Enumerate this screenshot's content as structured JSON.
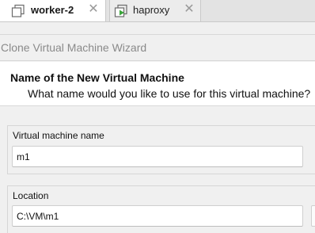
{
  "tabs": [
    {
      "label": "worker-2",
      "icon": "vm-window-icon",
      "active": true,
      "close_glyph": "✕"
    },
    {
      "label": "haproxy",
      "icon": "vm-running-icon",
      "active": false,
      "close_glyph": "✕"
    }
  ],
  "wizard": {
    "title": "Clone Virtual Machine Wizard",
    "page_title": "Name of the New Virtual Machine",
    "page_subtitle": "What name would you like to use for this virtual machine?",
    "name_label": "Virtual machine name",
    "name_value": "m1",
    "location_label": "Location",
    "location_value": "C:\\VM\\m1"
  },
  "colors": {
    "running_green": "#3aa53a",
    "tab_active_bg": "#ffffff",
    "tab_strip_bg": "#e3e3e3",
    "dialog_bg": "#f0f0f0"
  }
}
